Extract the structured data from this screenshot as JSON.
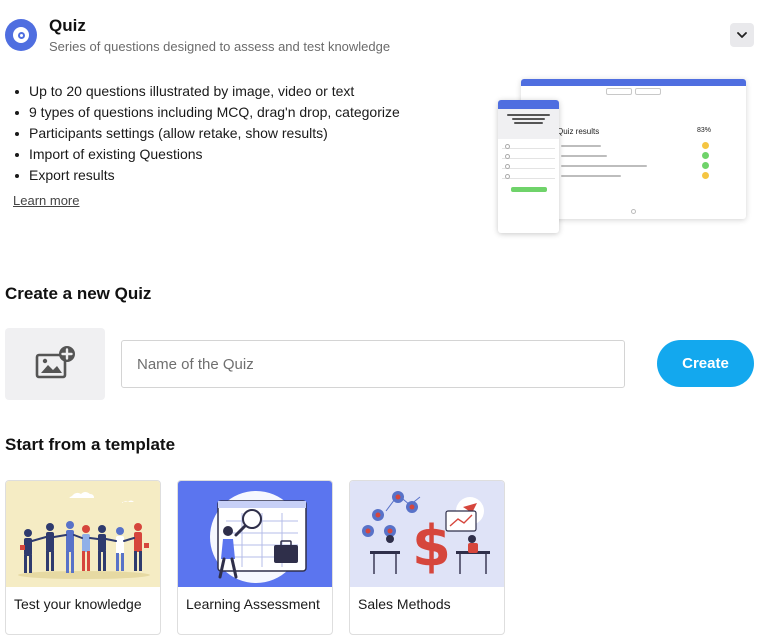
{
  "header": {
    "title": "Quiz",
    "subtitle": "Series of questions designed to assess and test knowledge"
  },
  "features": [
    "Up to 20 questions illustrated by image, video or text",
    "9 types of questions including MCQ, drag'n drop, categorize",
    "Participants settings (allow retake, show results)",
    "Import of existing Questions",
    "Export results"
  ],
  "learn_more": "Learn more",
  "preview": {
    "results_title": "Quiz results",
    "results_score": "83%",
    "colors": {
      "accent": "#4f6ee0",
      "correct": "#6fd36a",
      "partial": "#f5c542"
    }
  },
  "create": {
    "heading": "Create a new Quiz",
    "input_placeholder": "Name of the Quiz",
    "input_value": "",
    "button_label": "Create",
    "button_color": "#13a8ee"
  },
  "templates": {
    "heading": "Start from a template",
    "items": [
      {
        "label": "Test your knowledge",
        "bg": "#f5ecc4"
      },
      {
        "label": "Learning Assessment",
        "bg": "#5b75ef"
      },
      {
        "label": "Sales Methods",
        "bg": "#dfe3f7"
      }
    ]
  }
}
